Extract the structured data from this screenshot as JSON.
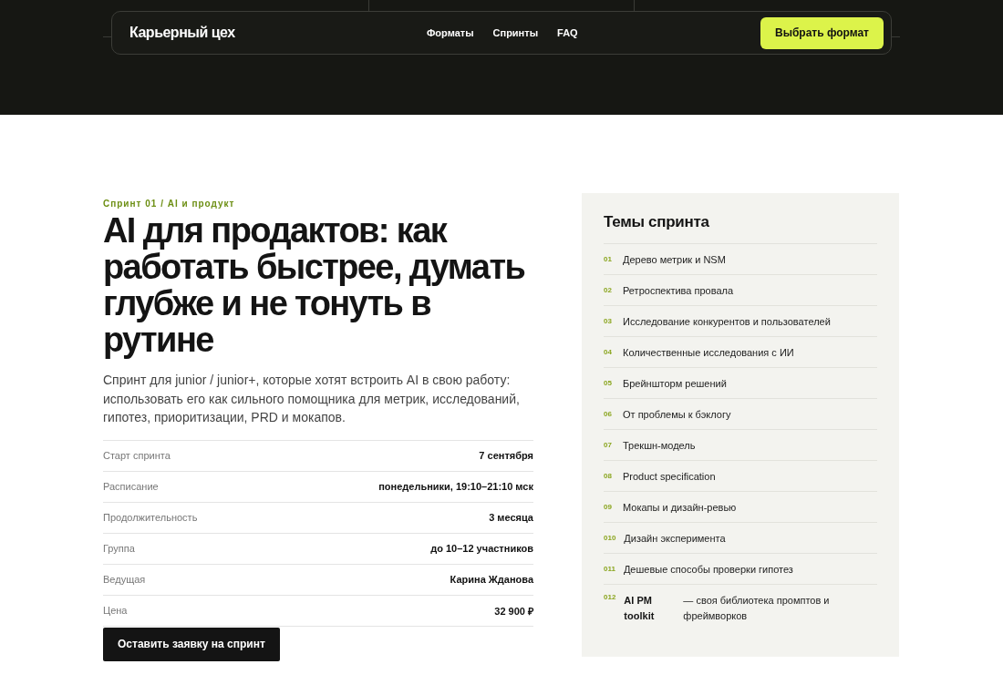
{
  "nav": {
    "logo": "Карьерный цех",
    "links": [
      {
        "label": "Форматы"
      },
      {
        "label": "Спринты"
      },
      {
        "label": "FAQ"
      }
    ],
    "cta": "Выбрать формат"
  },
  "sprint": {
    "eyebrow": "Спринт 01 / AI и продукт",
    "title": "AI для продактов: как работать быстрее, думать глубже и не тонуть в рутине",
    "description": "Спринт для junior / junior+, которые хотят встроить AI в свою работу: использовать его как сильного помощника для метрик, исследований, гипотез, приоритизации, PRD и мокапов.",
    "details": [
      {
        "label": "Старт спринта",
        "value": "7 сентября"
      },
      {
        "label": "Расписание",
        "value": "понедельники, 19:10–21:10 мск"
      },
      {
        "label": "Продолжительность",
        "value": "3 месяца"
      },
      {
        "label": "Группа",
        "value": "до 10–12 участников"
      },
      {
        "label": "Ведущая",
        "value": "Карина Жданова"
      },
      {
        "label": "Цена",
        "value": "32 900 ₽"
      }
    ],
    "apply_button": "Оставить заявку на спринт"
  },
  "topics": {
    "title": "Темы спринта",
    "items": [
      {
        "kind": "plain",
        "number": "01",
        "text": "Дерево метрик и NSM"
      },
      {
        "kind": "plain",
        "number": "02",
        "text": "Ретроспектива провала"
      },
      {
        "kind": "plain",
        "number": "03",
        "text": "Исследование конкурентов и пользователей"
      },
      {
        "kind": "plain",
        "number": "04",
        "text": "Количественные исследования с ИИ"
      },
      {
        "kind": "plain",
        "number": "05",
        "text": "Брейншторм решений"
      },
      {
        "kind": "plain",
        "number": "06",
        "text": "От проблемы к бэклогу"
      },
      {
        "kind": "plain",
        "number": "07",
        "text": "Трекшн-модель"
      },
      {
        "kind": "plain",
        "number": "08",
        "text": "Product specification"
      },
      {
        "kind": "plain",
        "number": "09",
        "text": "Мокапы и дизайн-ревью"
      },
      {
        "kind": "plain",
        "number": "010",
        "text": "Дизайн эксперимента"
      },
      {
        "kind": "plain",
        "number": "011",
        "text": "Дешевые способы проверки гипотез"
      },
      {
        "kind": "lead",
        "number": "012",
        "lead": "AI PM toolkit",
        "text": "— своя библиотека промптов и фреймворков"
      }
    ]
  }
}
